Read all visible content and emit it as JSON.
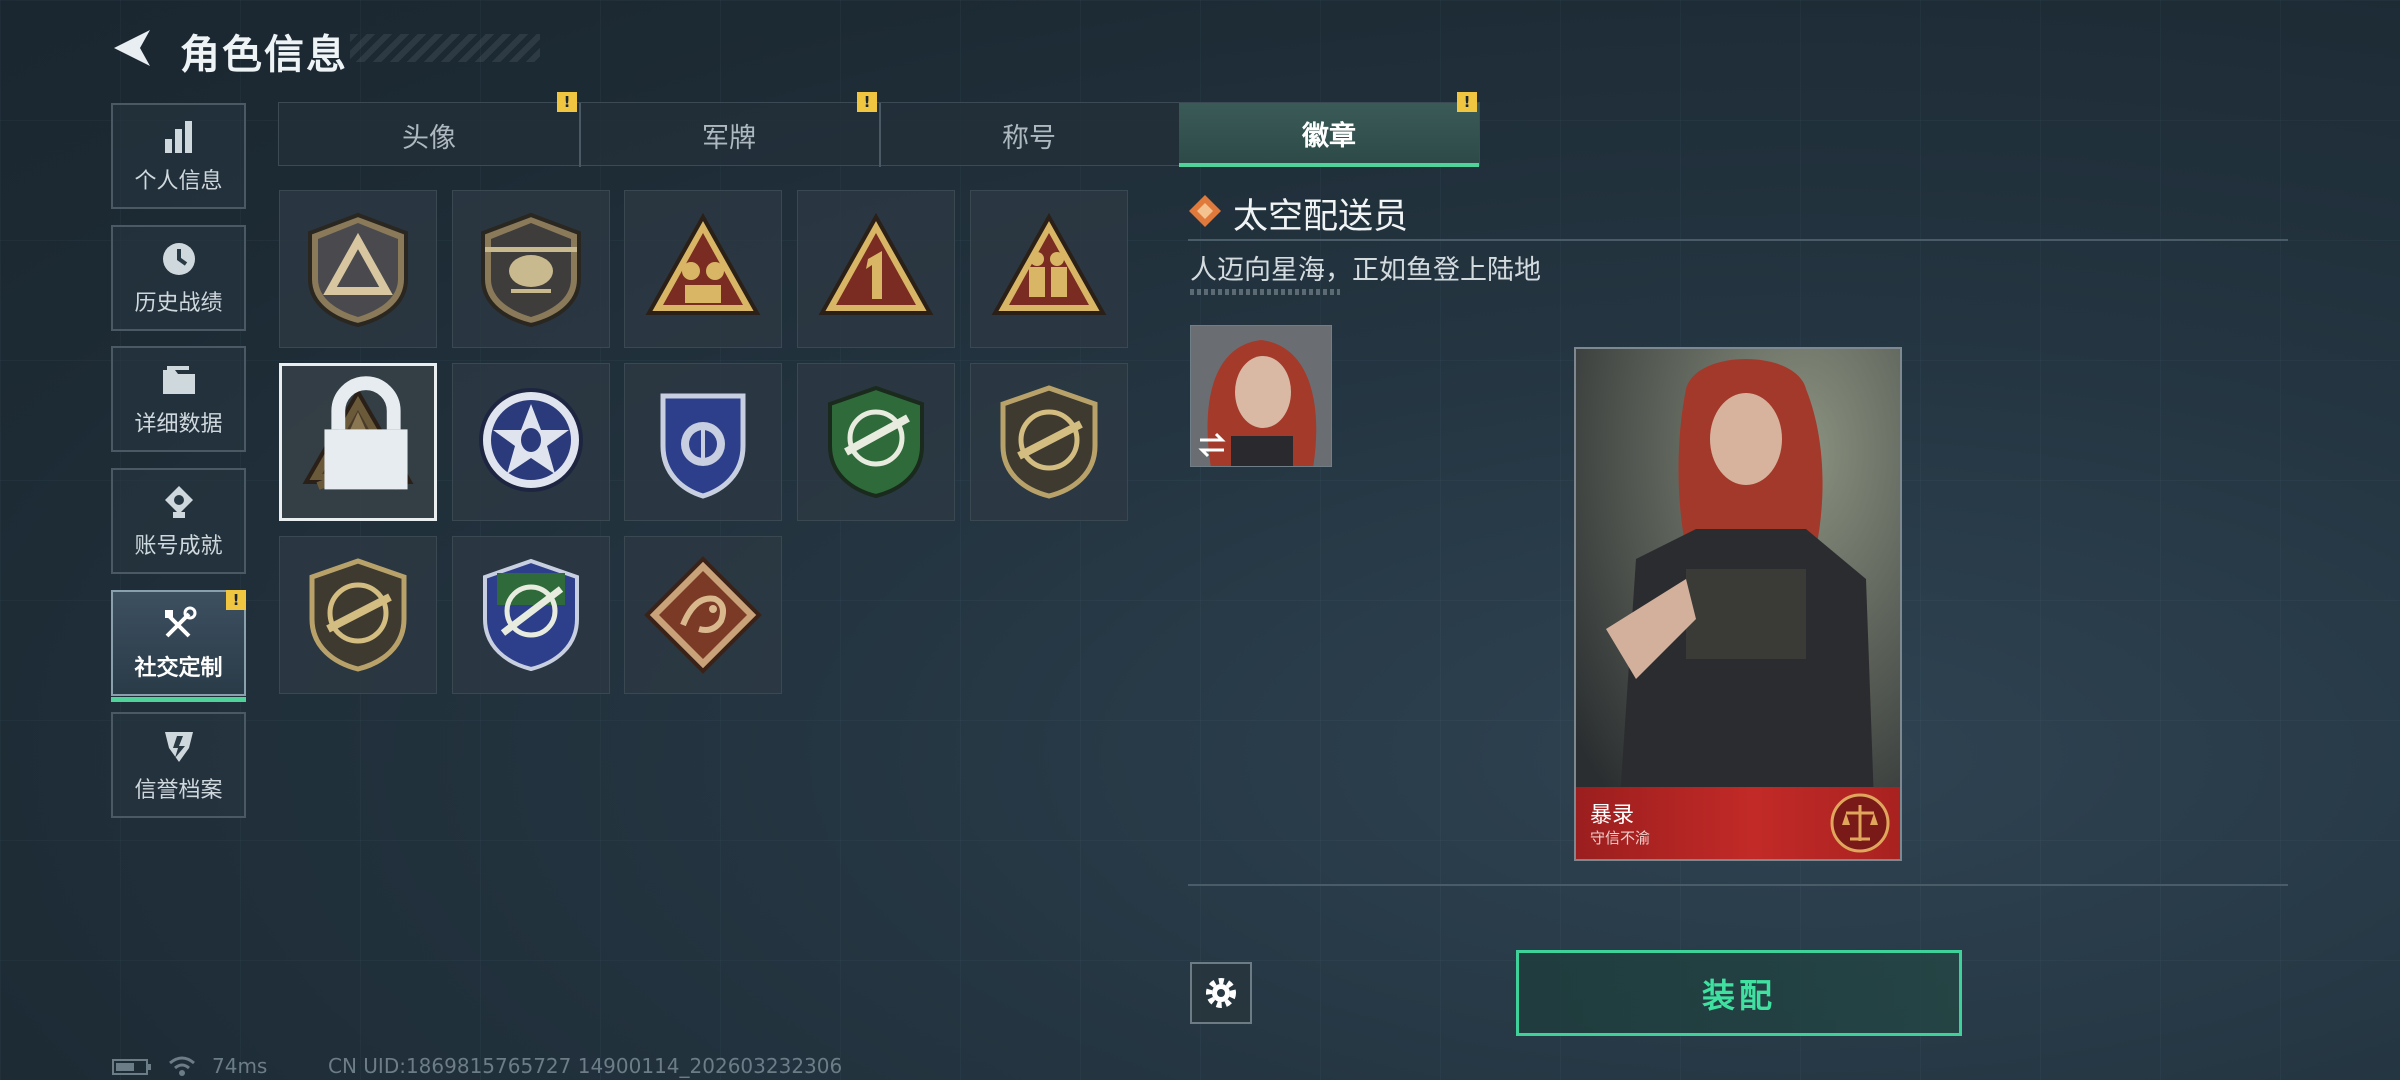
{
  "header": {
    "title": "角色信息"
  },
  "sidebar": {
    "items": [
      {
        "label": "个人信息",
        "icon": "bar-chart-icon",
        "active": false
      },
      {
        "label": "历史战绩",
        "icon": "history-clock-icon",
        "active": false
      },
      {
        "label": "详细数据",
        "icon": "folder-icon",
        "active": false
      },
      {
        "label": "账号成就",
        "icon": "achievement-icon",
        "active": false
      },
      {
        "label": "社交定制",
        "icon": "tools-icon",
        "active": true,
        "badge": "!"
      },
      {
        "label": "信誉档案",
        "icon": "credit-shield-icon",
        "active": false
      }
    ]
  },
  "tabs": [
    {
      "label": "头像",
      "badge": "!",
      "active": false
    },
    {
      "label": "军牌",
      "badge": "!",
      "active": false
    },
    {
      "label": "称号",
      "active": false
    },
    {
      "label": "徽章",
      "badge": "!",
      "active": true
    }
  ],
  "badges": [
    {
      "name": "triangle-shield-badge",
      "locked": false
    },
    {
      "name": "helicopter-badge",
      "locked": false
    },
    {
      "name": "s6-triangle-badge",
      "locked": false
    },
    {
      "name": "number-one-triangle-badge",
      "locked": false
    },
    {
      "name": "soldiers-triangle-badge",
      "locked": false
    },
    {
      "name": "rocket-triangle-badge",
      "locked": true,
      "selected": true
    },
    {
      "name": "star-skull-badge",
      "locked": false
    },
    {
      "name": "blue-shield-badge",
      "locked": false
    },
    {
      "name": "green-rifle-badge",
      "locked": false
    },
    {
      "name": "gold-rifle-badge",
      "locked": false
    },
    {
      "name": "gold-rifle-badge-2",
      "locked": false
    },
    {
      "name": "blue-knife-badge",
      "locked": false
    },
    {
      "name": "dragon-diamond-badge",
      "locked": false
    }
  ],
  "detail": {
    "name": "太空配送员",
    "motto": "人迈向星海，正如鱼登上陆地"
  },
  "card": {
    "name": "暴录",
    "subtitle": "守信不渝"
  },
  "actions": {
    "equip_label": "装配"
  },
  "footer": {
    "ping": "74ms",
    "uid": "CN UID:1869815765727 14900114_202603232306"
  },
  "colors": {
    "accent": "#4fd39a",
    "warning": "#f0c540",
    "card_red": "#c22a27"
  }
}
